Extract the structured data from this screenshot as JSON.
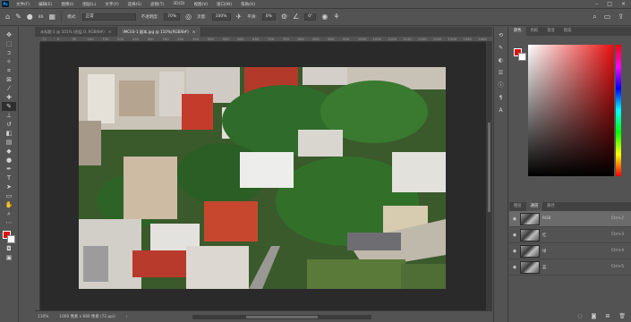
{
  "app": {
    "logo": "Ps"
  },
  "menu": [
    "文件(F)",
    "编辑(E)",
    "图像(I)",
    "图层(L)",
    "文字(Y)",
    "选择(S)",
    "滤镜(T)",
    "3D(D)",
    "视图(V)",
    "窗口(W)",
    "帮助(H)"
  ],
  "options": {
    "mode_label": "模式:",
    "mode_value": "正常",
    "opacity_label": "不透明度:",
    "opacity_value": "70%",
    "flow_label": "流量:",
    "flow_value": "100%",
    "smooth_label": "平滑:",
    "smooth_value": "0%",
    "angle_value": "0°",
    "brush_size": "86"
  },
  "tabs": [
    {
      "label": "未标题-1 @ 101% (图层 0, RGB/8#)",
      "close": "×"
    },
    {
      "label": "IMC03-1 副本.jpg @ 110%(RGB/8#)",
      "close": "×",
      "active": true
    }
  ],
  "ruler": [
    "72",
    "0",
    "50",
    "100",
    "150",
    "200",
    "250",
    "300",
    "350",
    "400",
    "450",
    "500",
    "550",
    "600",
    "650",
    "700",
    "750",
    "800",
    "850",
    "900",
    "950",
    "1000",
    "1050",
    "1100",
    "1150",
    "1200",
    "1250",
    "1300",
    "1350",
    "1400"
  ],
  "status": {
    "zoom": "110%",
    "doc": "1000 像素 x 666 像素 (72 ppi)",
    "arrow": "›"
  },
  "panel_tabs_top": [
    "颜色",
    "色板",
    "渐变",
    "图案"
  ],
  "panel_tabs_bottom": [
    "图层",
    "通道",
    "路径"
  ],
  "channels": [
    {
      "name": "RGB",
      "key": "Ctrl+2"
    },
    {
      "name": "红",
      "key": "Ctrl+3"
    },
    {
      "name": "绿",
      "key": "Ctrl+4"
    },
    {
      "name": "蓝",
      "key": "Ctrl+5"
    }
  ],
  "colors": {
    "foreground": "#e01010",
    "background": "#ffffff"
  }
}
